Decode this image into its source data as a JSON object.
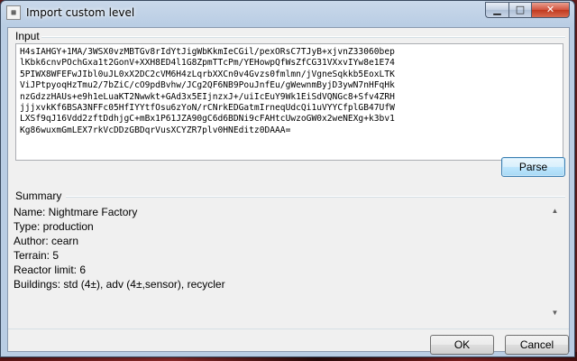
{
  "window": {
    "title": "Import custom level",
    "app_icon": "app-icon",
    "minimize_glyph": "▁",
    "maximize_glyph": "□",
    "close_glyph": "✕"
  },
  "input_section": {
    "label": "Input",
    "text": "H4sIAHGY+1MA/3WSX0vzMBTGv8rIdYtJigWbKkmIeCGil/pexORsC7TJyB+xjvnZ33060bep\nlKbk6cnvPOchGxa1t2GonV+XXH8ED4l1G8ZpmTTcPm/YEHowpQfWsZfCG31VXxvIYw8e1E74\n5PIWX8WFEFwJIbl0uJL0xX2DC2cVM6H4zLqrbXXCn0v4Gvzs0fmlmn/jVgneSqkkb5EoxLTK\nViJPtpyoqHzTmu2/7bZiC/cO9pdBvhw/JCg2QF6NB9PouJnfEu/gWewnmByjD3ywN7nHFqHk\nnzGdzzHAUs+e9h1eLuaKT2Nwwkt+GAd3x5EIjnzxJ+/uiIcEuY9Wk1EiSdVQNGc8+Sfv4ZRH\njjjxvkKf6BSA3NFFc05HfIYYtfOsu6zYoN/rCNrkEDGatmIrneqUdcQi1uVYYCfplGB47UfW\nLXSf9qJ16Vdd2zftDdhjgC+mBx1P61JZA90gC6d6BDNi9cFAHtcUwzoGW0x2weNEXg+k3bv1\nKg86wuxmGmLEX7rkVcDDzGBDqrVusXCYZR7plv0HNEditz0DAAA="
  },
  "parse_button": "Parse",
  "summary_section": {
    "label": "Summary",
    "lines": [
      "Name: Nightmare Factory",
      "Type: production",
      "Author: cearn",
      "Terrain: 5",
      "Reactor limit: 6",
      "Buildings: std (4±), adv (4±,sensor), recycler"
    ]
  },
  "footer": {
    "ok_label": "OK",
    "cancel_label": "Cancel"
  },
  "colors": {
    "title_gradient": "#c9d8ea",
    "client_bg": "#f0f0f0",
    "close_button": "#c0391f",
    "parse_focus": "#3c7fb1"
  }
}
